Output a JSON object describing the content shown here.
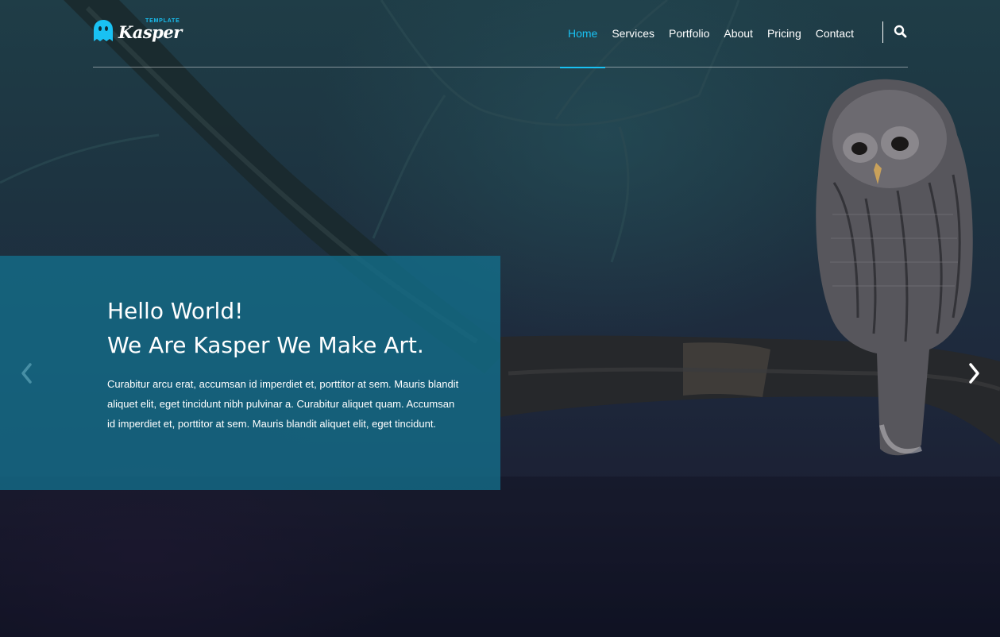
{
  "brand": {
    "name": "Kasper",
    "tag": "TEMPLATE",
    "accent_color": "#19c1f3"
  },
  "nav": {
    "items": [
      {
        "label": "Home",
        "active": true
      },
      {
        "label": "Services"
      },
      {
        "label": "Portfolio"
      },
      {
        "label": "About"
      },
      {
        "label": "Pricing"
      },
      {
        "label": "Contact"
      }
    ],
    "search_icon": "search-icon"
  },
  "slider": {
    "prev_icon": "chevron-left-icon",
    "next_icon": "chevron-right-icon",
    "caption": {
      "title_line1": "Hello World!",
      "title_line2": "We Are Kasper We Make Art.",
      "text": "Curabitur arcu erat, accumsan id imperdiet et, porttitor at sem. Mauris blandit aliquet elit, eget tincidunt nibh pulvinar a. Curabitur aliquet quam. Accumsan id imperdiet et, porttitor at sem. Mauris blandit aliquet elit, eget tincidunt.",
      "background_color": "#13708c"
    }
  }
}
